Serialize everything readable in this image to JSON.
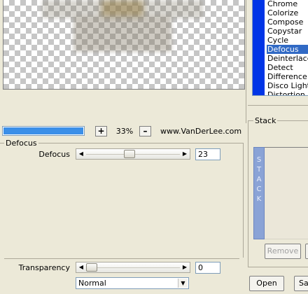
{
  "effects": {
    "items": [
      "Chrome",
      "Colorize",
      "Compose",
      "Copystar",
      "Cycle",
      "Defocus",
      "Deinterlace",
      "Detect",
      "Difference",
      "Disco Lights",
      "Distortion"
    ],
    "selected": "Defocus"
  },
  "zoom": {
    "in_label": "+",
    "level": "33%",
    "out_label": "–",
    "progress_fraction": 1.0
  },
  "website": "www.VanDerLee.com",
  "effect_group": {
    "title": "Defocus",
    "defocus_label": "Defocus",
    "defocus_value": "23",
    "defocus_fraction": 0.46,
    "transparency_label": "Transparency",
    "transparency_value": "0",
    "transparency_fraction": 0.0,
    "blend_mode": "Normal"
  },
  "stack": {
    "title": "Stack",
    "vertical_label": [
      "S",
      "T",
      "A",
      "C",
      "K"
    ],
    "remove_label": "Remove"
  },
  "buttons": {
    "open": "Open",
    "save": "Sa"
  },
  "colors": {
    "selection": "#316ac5",
    "list_stripe": "#0035e6",
    "progress": "#3b8fe8",
    "stack_bar": "#8aa3d6"
  }
}
